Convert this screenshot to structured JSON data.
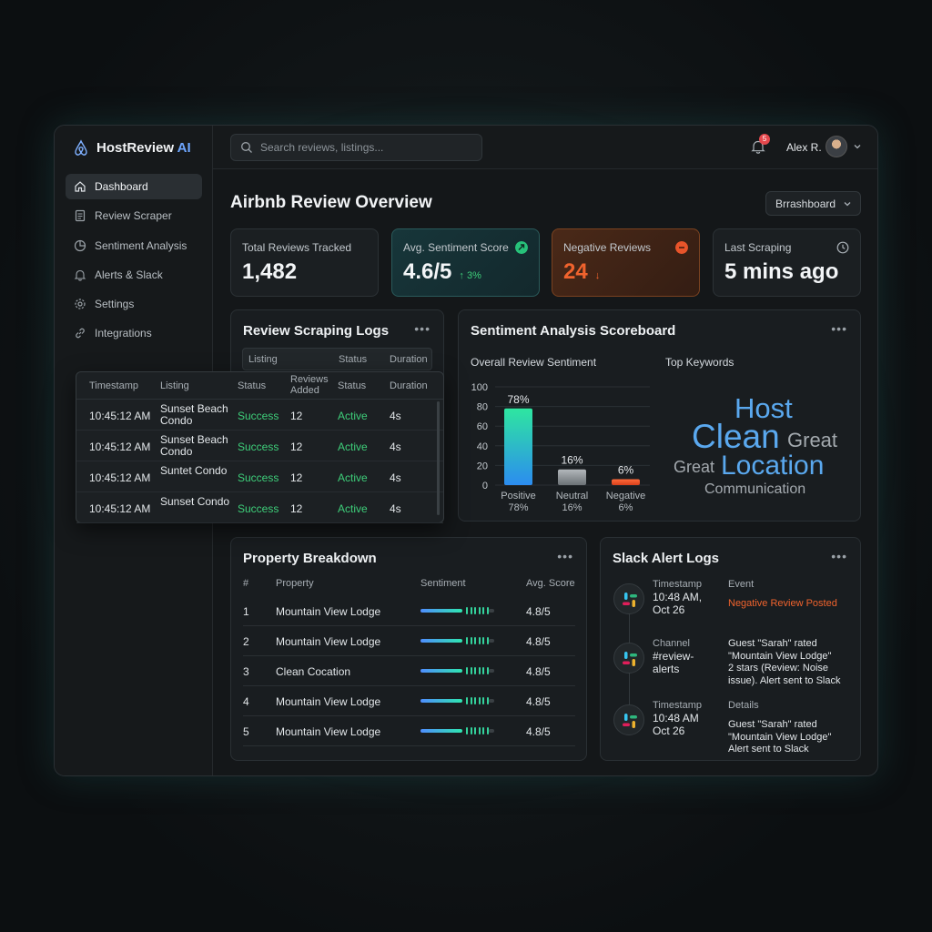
{
  "brand": {
    "name": "HostReview",
    "suffix": "AI"
  },
  "sidebar": {
    "items": [
      {
        "label": "Dashboard",
        "icon": "home-icon",
        "active": true
      },
      {
        "label": "Review Scraper",
        "icon": "document-icon"
      },
      {
        "label": "Sentiment Analysis",
        "icon": "pie-chart-icon"
      },
      {
        "label": "Alerts & Slack",
        "icon": "bell-icon"
      },
      {
        "label": "Settings",
        "icon": "gear-icon"
      },
      {
        "label": "Integrations",
        "icon": "link-icon"
      }
    ]
  },
  "topbar": {
    "search_placeholder": "Search reviews, listings...",
    "notification_count": "5",
    "user_name": "Alex R."
  },
  "main": {
    "title": "Airbnb Review Overview",
    "dashboard_select": "Brrashboard"
  },
  "kpis": [
    {
      "label": "Total Reviews Tracked",
      "value": "1,482",
      "delta": ""
    },
    {
      "label": "Avg. Sentiment Score",
      "value": "4.6/5",
      "delta": "↑ 3%"
    },
    {
      "label": "Negative Reviews",
      "value": "24",
      "delta": "↓"
    },
    {
      "label": "Last Scraping",
      "value": "5 mins ago",
      "delta": ""
    }
  ],
  "scraping_logs": {
    "title": "Review Scraping Logs",
    "mini_head": [
      "Listing",
      "Status",
      "Duration"
    ],
    "columns": [
      "Timestamp",
      "Listing",
      "Status",
      "Reviews Added",
      "Status",
      "Duration"
    ],
    "rows": [
      {
        "time": "10:45:12 AM",
        "listing": "Sunset Beach Condo",
        "status": "Success",
        "added": "12",
        "state": "Active",
        "duration": "4s"
      },
      {
        "time": "10:45:12 AM",
        "listing": "Sunset Beach Condo",
        "status": "Success",
        "added": "12",
        "state": "Active",
        "duration": "4s"
      },
      {
        "time": "10:45:12 AM",
        "listing": "Suntet Condo",
        "status": "Success",
        "added": "12",
        "state": "Active",
        "duration": "4s"
      },
      {
        "time": "10:45:12 AM",
        "listing": "Sunset Condo",
        "status": "Success",
        "added": "12",
        "state": "Active",
        "duration": "4s"
      }
    ]
  },
  "sentiment": {
    "title": "Sentiment Analysis Scoreboard",
    "chart_title": "Overall Review Sentiment",
    "keywords_title": "Top Keywords",
    "keywords": [
      "Host",
      "Clean",
      "Great",
      "Great",
      "Location",
      "Communication"
    ]
  },
  "chart_data": {
    "type": "bar",
    "title": "Overall Review Sentiment",
    "categories": [
      "Positive",
      "Neutral",
      "Negative"
    ],
    "values": [
      78,
      16,
      6
    ],
    "value_labels": [
      "78%",
      "16%",
      "6%"
    ],
    "category_sublabels": [
      "78%",
      "16%",
      "6%"
    ],
    "ylim": [
      0,
      100
    ],
    "yticks": [
      0,
      20,
      40,
      60,
      80,
      100
    ],
    "colors": [
      "#2ee6a0",
      "#9a9fa4",
      "#f0542d"
    ]
  },
  "properties": {
    "title": "Property Breakdown",
    "columns": [
      "#",
      "Property",
      "Sentiment",
      "Avg. Score"
    ],
    "rows": [
      {
        "n": "1",
        "name": "Mountain View Lodge",
        "sentiment": 0.82,
        "score": "4.8/5"
      },
      {
        "n": "2",
        "name": "Mountain View Lodge",
        "sentiment": 0.82,
        "score": "4.8/5"
      },
      {
        "n": "3",
        "name": "Clean Cocation",
        "sentiment": 0.82,
        "score": "4.8/5"
      },
      {
        "n": "4",
        "name": "Mountain View Lodge",
        "sentiment": 0.82,
        "score": "4.8/5"
      },
      {
        "n": "5",
        "name": "Mountain View Lodge",
        "sentiment": 0.82,
        "score": "4.8/5"
      }
    ]
  },
  "slack": {
    "title": "Slack Alert Logs",
    "items": [
      {
        "left_label": "Timestamp",
        "left_value": "10:48 AM,\nOct 26",
        "right_label": "Event",
        "right_value": "Negative Review Posted"
      },
      {
        "left_label": "Channel",
        "left_value": "#review-\nalerts",
        "right_label": "",
        "right_value": "Guest \"Sarah\" rated\n\"Mountain View Lodge\"\n2 stars (Review: Noise\nissue). Alert sent to Slack"
      },
      {
        "left_label": "Timestamp",
        "left_value": "10:48 AM\nOct 26",
        "right_label": "Details",
        "right_value": "Guest \"Sarah\" rated\n\"Mountain View Lodge\"\nAlert sent to Slack"
      }
    ]
  },
  "colors": {
    "accent": "#6ea6ff",
    "success": "#3ecf7a",
    "negative": "#f0542d",
    "positive": "#2ee6a0"
  }
}
